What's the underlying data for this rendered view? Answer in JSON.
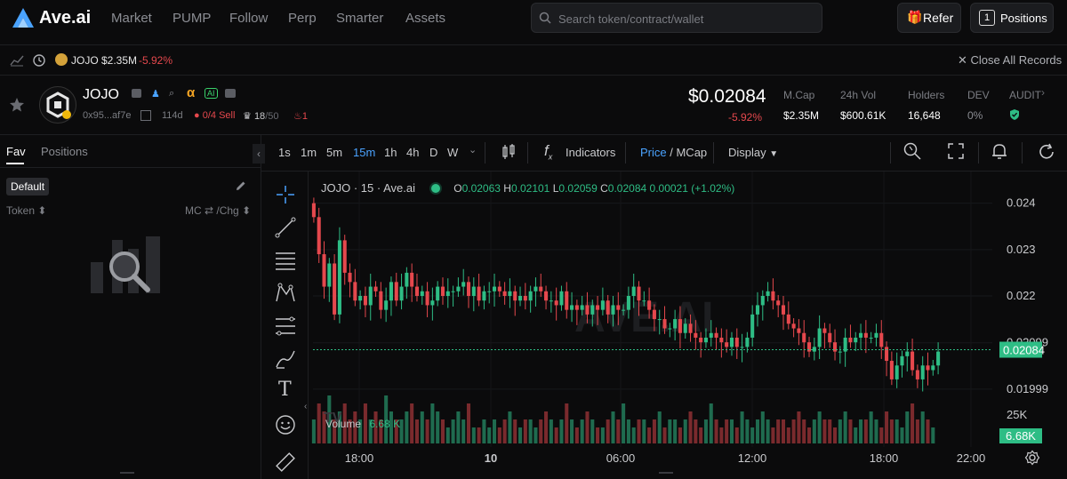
{
  "brand": {
    "name": "Ave.ai",
    "accent": "#4aa3ff"
  },
  "nav": {
    "items": [
      "Market",
      "PUMP",
      "Follow",
      "Perp",
      "Smarter",
      "Assets"
    ]
  },
  "search": {
    "placeholder": "Search token/contract/wallet"
  },
  "header_buttons": {
    "refer": "Refer",
    "positions_count": "1",
    "positions": "Positions"
  },
  "tabbar": {
    "tab_label": "JOJO $2.35M",
    "tab_change": "-5.92%",
    "close_all": "Close All Records"
  },
  "token": {
    "name": "JOJO",
    "address": "0x95...af7e",
    "age": "114d",
    "sell_ratio": "0/4 Sell",
    "holders_badge_a": "18",
    "holders_badge_b": "/50",
    "fire_count": "1",
    "price": "$0.02084",
    "change": "-5.92%",
    "stats": [
      {
        "label": "M.Cap",
        "value": "$2.35M"
      },
      {
        "label": "24h Vol",
        "value": "$600.61K"
      },
      {
        "label": "Holders",
        "value": "16,648"
      },
      {
        "label": "DEV",
        "value": "0%"
      },
      {
        "label": "AUDIT",
        "value": ""
      }
    ]
  },
  "left_panel": {
    "tabs": [
      "Fav",
      "Positions"
    ],
    "group": "Default",
    "col_token": "Token",
    "col_mc": "MC ⇄ /Chg"
  },
  "chart_toolbar": {
    "timeframes": [
      "1s",
      "1m",
      "5m",
      "15m",
      "1h",
      "4h",
      "D",
      "W"
    ],
    "active_timeframe": "15m",
    "indicators": "Indicators",
    "price_label": "Price",
    "mcap_label": "/ MCap",
    "display": "Display"
  },
  "chart_legend": {
    "symbol": "JOJO · 15 · Ave.ai",
    "o_label": "O",
    "o": "0.02063",
    "h_label": "H",
    "h": "0.02101",
    "l_label": "L",
    "l": "0.02059",
    "c_label": "C",
    "c": "0.02084",
    "change": "0.00021 (+1.02%)",
    "volume_label": "Volume",
    "volume_value": "6.68 K",
    "watermark": "AVE.AI"
  },
  "chart_data": {
    "type": "candlestick",
    "price_axis": [
      "0.024",
      "0.023",
      "0.022",
      "0.02099",
      "0.01999"
    ],
    "volume_axis": [
      "25K"
    ],
    "time_axis": [
      "18:00",
      "10",
      "06:00",
      "12:00",
      "18:00",
      "22:00"
    ],
    "last_price": "0.02084",
    "last_volume": "6.68K",
    "ylim": [
      0.0197,
      0.0243
    ],
    "colors": {
      "up": "#2ebd85",
      "down": "#e5484d"
    },
    "close_series": [
      0.0237,
      0.0229,
      0.0222,
      0.0227,
      0.0216,
      0.0232,
      0.0225,
      0.0223,
      0.0219,
      0.022,
      0.0218,
      0.0222,
      0.0221,
      0.0217,
      0.0219,
      0.0223,
      0.0219,
      0.0222,
      0.0225,
      0.0222,
      0.022,
      0.0221,
      0.0218,
      0.0219,
      0.0222,
      0.022,
      0.0221,
      0.0221,
      0.0222,
      0.0223,
      0.022,
      0.0222,
      0.0219,
      0.0221,
      0.0221,
      0.0222,
      0.0221,
      0.022,
      0.0221,
      0.0219,
      0.022,
      0.0219,
      0.0221,
      0.0222,
      0.0221,
      0.0219,
      0.0219,
      0.0218,
      0.0221,
      0.0217,
      0.0218,
      0.0217,
      0.0218,
      0.0216,
      0.0218,
      0.0217,
      0.0219,
      0.0216,
      0.0218,
      0.0217,
      0.0217,
      0.022,
      0.0222,
      0.0219,
      0.0219,
      0.0217,
      0.0215,
      0.0215,
      0.0213,
      0.0213,
      0.0215,
      0.0212,
      0.0214,
      0.0212,
      0.0211,
      0.021,
      0.0211,
      0.0212,
      0.0211,
      0.021,
      0.0209,
      0.0211,
      0.0209,
      0.0209,
      0.0211,
      0.0216,
      0.0218,
      0.022,
      0.0221,
      0.0219,
      0.0218,
      0.0216,
      0.0214,
      0.0213,
      0.0212,
      0.021,
      0.0208,
      0.0209,
      0.0213,
      0.0212,
      0.021,
      0.0208,
      0.0208,
      0.0211,
      0.021,
      0.0211,
      0.0212,
      0.0211,
      0.0211,
      0.0212,
      0.0209,
      0.0206,
      0.0202,
      0.0205,
      0.0207,
      0.0208,
      0.0204,
      0.0202,
      0.0205,
      0.0204,
      0.0205,
      0.0208
    ],
    "volume_series": [
      3,
      5,
      4,
      6,
      3,
      4,
      5,
      3,
      4,
      3,
      5,
      3,
      4,
      3,
      6,
      4,
      3,
      3,
      4,
      5,
      3,
      4,
      3,
      5,
      4,
      3,
      2,
      3,
      4,
      3,
      5,
      2,
      2,
      3,
      2,
      3,
      2,
      3,
      4,
      3,
      2,
      3,
      3,
      2,
      3,
      4,
      3,
      2,
      3,
      5,
      3,
      2,
      3,
      4,
      3,
      2,
      2,
      3,
      4,
      3,
      5,
      3,
      2,
      3,
      3,
      2,
      3,
      4,
      2,
      3,
      3,
      2,
      3,
      4,
      3,
      2,
      3,
      5,
      3,
      2,
      3,
      3,
      2,
      4,
      3,
      2,
      3,
      4,
      3,
      2,
      3,
      3,
      2,
      3,
      4,
      3,
      2,
      3,
      4,
      3,
      3,
      2,
      3,
      4,
      3,
      2,
      3,
      3,
      4,
      3,
      2,
      4,
      3,
      3,
      2,
      4,
      5,
      3,
      4,
      3,
      2
    ]
  }
}
